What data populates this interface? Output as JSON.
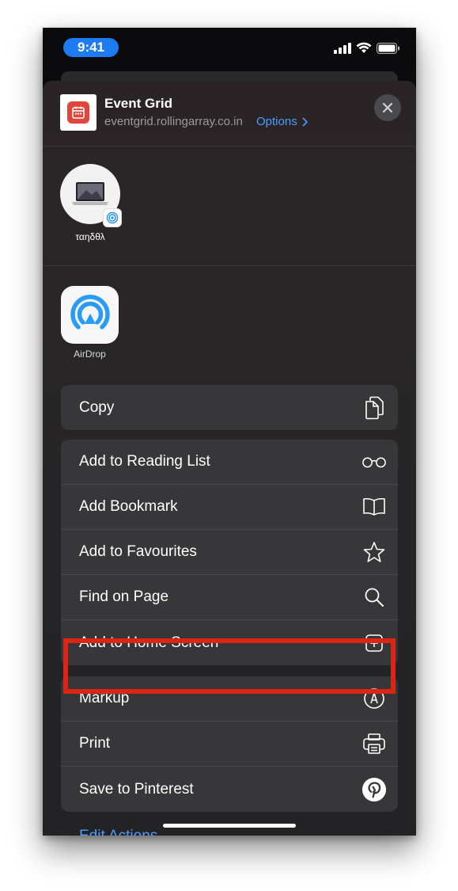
{
  "status_bar": {
    "time": "9:41"
  },
  "header": {
    "title": "Event Grid",
    "url": "eventgrid.rollingarray.co.in",
    "options_label": "Options"
  },
  "people": [
    {
      "name": "ταηδθλ",
      "avatar": "laptop-icon",
      "badge": "airdrop-icon"
    }
  ],
  "apps": [
    {
      "name": "AirDrop",
      "icon": "airdrop-icon"
    }
  ],
  "action_groups": [
    [
      {
        "label": "Copy",
        "icon": "copy-icon"
      }
    ],
    [
      {
        "label": "Add to Reading List",
        "icon": "glasses-icon"
      },
      {
        "label": "Add Bookmark",
        "icon": "book-icon"
      },
      {
        "label": "Add to Favourites",
        "icon": "star-icon"
      },
      {
        "label": "Find on Page",
        "icon": "search-icon"
      },
      {
        "label": "Add to Home Screen",
        "icon": "add-square-icon"
      }
    ],
    [
      {
        "label": "Markup",
        "icon": "markup-icon"
      },
      {
        "label": "Print",
        "icon": "printer-icon"
      },
      {
        "label": "Save to Pinterest",
        "icon": "pinterest-icon"
      }
    ]
  ],
  "edit_actions_label": "Edit Actions...",
  "colors": {
    "accent": "#4a9dff",
    "highlight": "#dc2514",
    "time_pill": "#1e7cf2"
  }
}
